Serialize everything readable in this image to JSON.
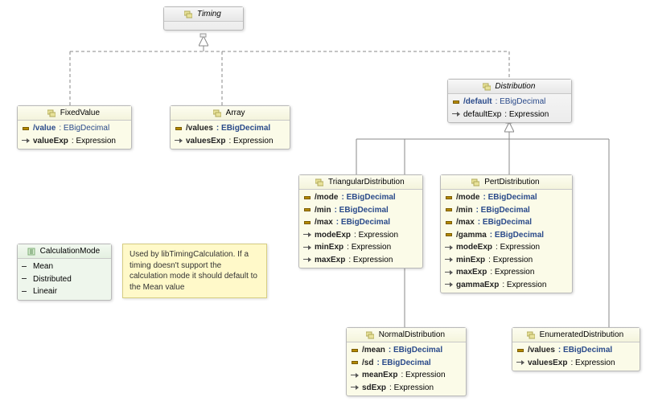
{
  "root": {
    "name": "Timing"
  },
  "fixedValue": {
    "name": "FixedValue",
    "a1_name": "/value",
    "a1_type": "EBigDecimal",
    "r1_name": "valueExp",
    "r1_type": "Expression"
  },
  "array": {
    "name": "Array",
    "a1_name": "/values",
    "a1_type": "EBigDecimal",
    "r1_name": "valuesExp",
    "r1_type": "Expression"
  },
  "distribution": {
    "name": "Distribution",
    "a1_name": "/default",
    "a1_type": "EBigDecimal",
    "r1_name": "defaultExp",
    "r1_type": "Expression"
  },
  "triangular": {
    "name": "TriangularDistribution",
    "a1_name": "/mode",
    "a1_type": "EBigDecimal",
    "a2_name": "/min",
    "a2_type": "EBigDecimal",
    "a3_name": "/max",
    "a3_type": "EBigDecimal",
    "r1_name": "modeExp",
    "r1_type": "Expression",
    "r2_name": "minExp",
    "r2_type": "Expression",
    "r3_name": "maxExp",
    "r3_type": "Expression"
  },
  "pert": {
    "name": "PertDistribution",
    "a1_name": "/mode",
    "a1_type": "EBigDecimal",
    "a2_name": "/min",
    "a2_type": "EBigDecimal",
    "a3_name": "/max",
    "a3_type": "EBigDecimal",
    "a4_name": "/gamma",
    "a4_type": "EBigDecimal",
    "r1_name": "modeExp",
    "r1_type": "Expression",
    "r2_name": "minExp",
    "r2_type": "Expression",
    "r3_name": "maxExp",
    "r3_type": "Expression",
    "r4_name": "gammaExp",
    "r4_type": "Expression"
  },
  "normal": {
    "name": "NormalDistribution",
    "a1_name": "/mean",
    "a1_type": "EBigDecimal",
    "a2_name": "/sd",
    "a2_type": "EBigDecimal",
    "r1_name": "meanExp",
    "r1_type": "Expression",
    "r2_name": "sdExp",
    "r2_type": "Expression"
  },
  "enumerated": {
    "name": "EnumeratedDistribution",
    "a1_name": "/values",
    "a1_type": "EBigDecimal",
    "r1_name": "valuesExp",
    "r1_type": "Expression"
  },
  "calcMode": {
    "name": "CalculationMode",
    "l1": "Mean",
    "l2": "Distributed",
    "l3": "Lineair"
  },
  "note": {
    "text": "Used by libTimingCalculation. If a timing doesn't support the calculation mode it should default to the Mean value"
  },
  "sep": " : "
}
